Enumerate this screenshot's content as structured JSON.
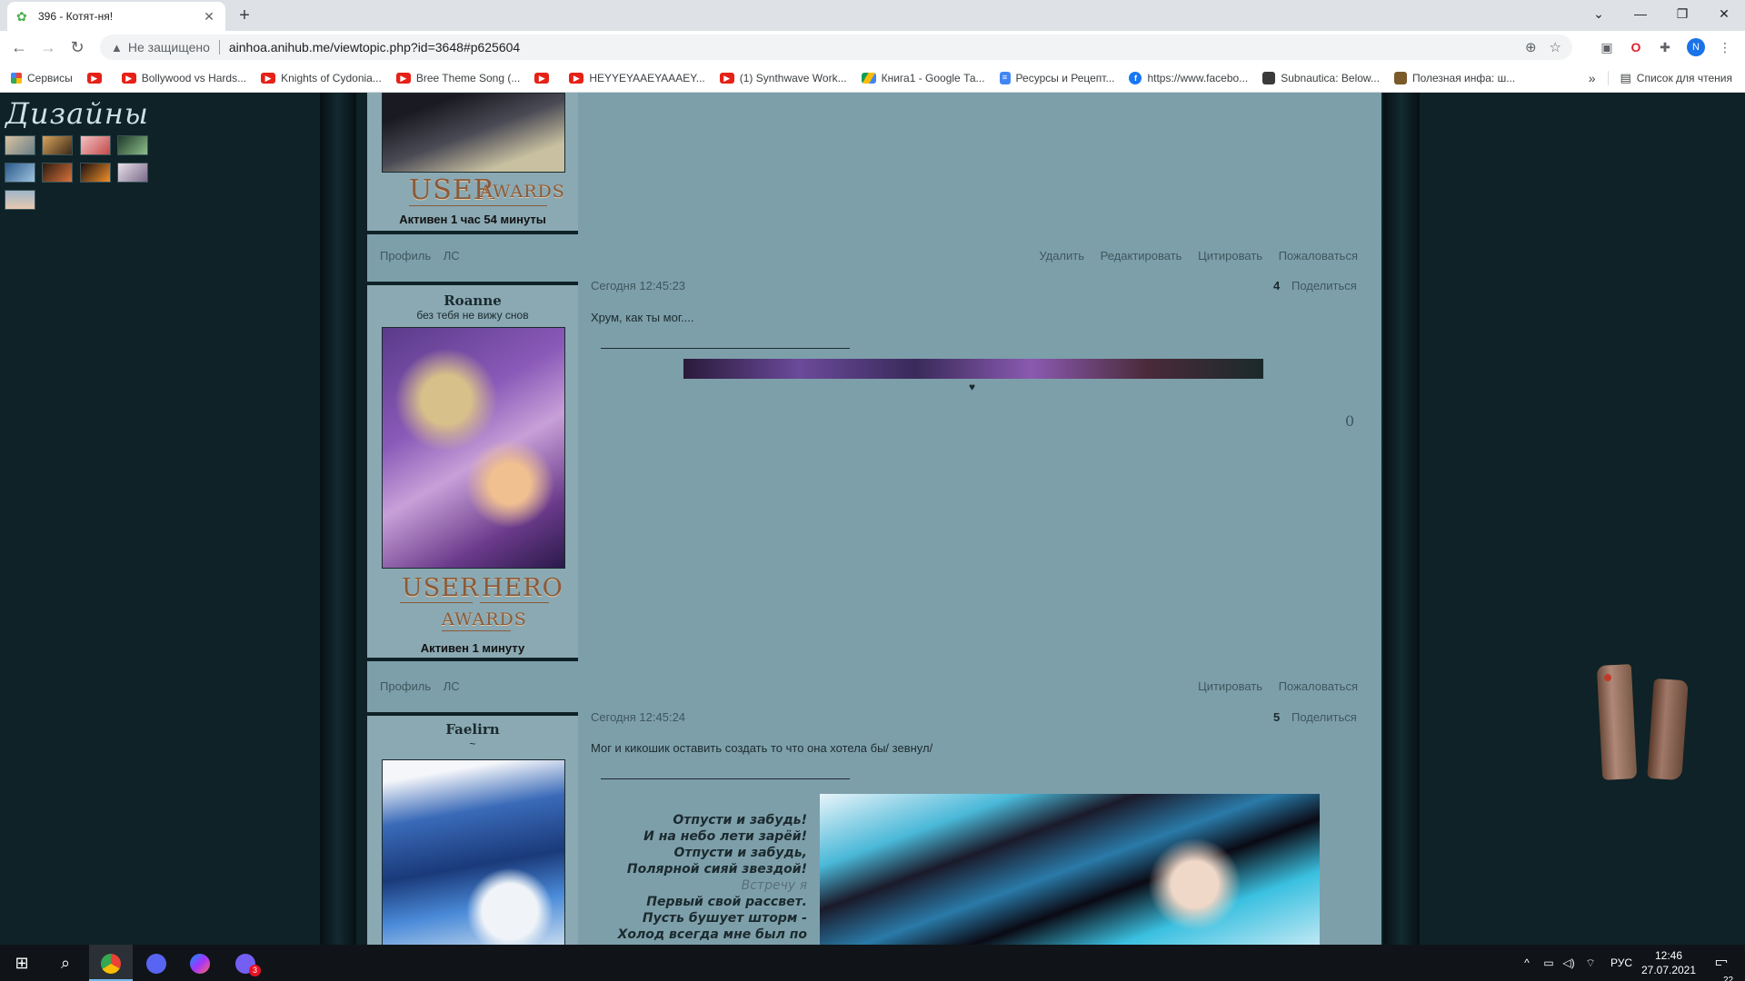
{
  "browser": {
    "tab_title": "396 - Котят-ня!",
    "tab_close": "✕",
    "new_tab": "+",
    "security_label": "Не защищено",
    "url": "ainhoa.anihub.me/viewtopic.php?id=3648#p625604",
    "profile_initial": "N",
    "bookmarks": [
      {
        "label": "Сервисы",
        "icon": "apps-icon"
      },
      {
        "label": "",
        "icon": "youtube-icon"
      },
      {
        "label": "Bollywood vs Hards...",
        "icon": "youtube-icon"
      },
      {
        "label": "Knights of Cydonia...",
        "icon": "youtube-icon"
      },
      {
        "label": "Bree Theme Song (...",
        "icon": "youtube-icon"
      },
      {
        "label": "",
        "icon": "youtube-icon"
      },
      {
        "label": "HEYYEYAAEYAAAEY...",
        "icon": "youtube-icon"
      },
      {
        "label": "(1) Synthwave Work...",
        "icon": "youtube-icon"
      },
      {
        "label": "Книга1 - Google Та...",
        "icon": "drive-icon"
      },
      {
        "label": "Ресурсы и Рецепт...",
        "icon": "docs-icon"
      },
      {
        "label": "https://www.facebo...",
        "icon": "facebook-icon"
      },
      {
        "label": "Subnautica: Below...",
        "icon": "site-icon"
      },
      {
        "label": "Полезная инфа: ш...",
        "icon": "site-icon"
      }
    ],
    "bookmarks_more": "»",
    "reading_list": "Список для чтения"
  },
  "sidebar": {
    "title": "Дизайны"
  },
  "posts": [
    {
      "active": "Активен 1 час 54 минуты",
      "award_left": "USER",
      "award_right": "AWARDS",
      "links_left": [
        "Профиль",
        "ЛС"
      ],
      "links_right": [
        "Удалить",
        "Редактировать",
        "Цитировать",
        "Пожаловаться"
      ]
    },
    {
      "username": "Roanne",
      "usertitle": "без тебя не вижу снов",
      "date": "Сегодня 12:45:23",
      "num": "4",
      "share": "Поделиться",
      "text": "Хрум, как ты мог....",
      "heart": "♥",
      "score": "0",
      "award_1": "USER",
      "award_2": "HERO",
      "award_3": "AWARDS",
      "active": "Активен 1 минуту",
      "links_left": [
        "Профиль",
        "ЛС"
      ],
      "links_right": [
        "Цитировать",
        "Пожаловаться"
      ]
    },
    {
      "username": "Faelirn",
      "usertitle": "~",
      "date": "Сегодня 12:45:24",
      "num": "5",
      "share": "Поделиться",
      "text": "Мог и кикошик оставить создать то что она хотела бы/ зевнул/",
      "poem": [
        "Отпусти и забудь!",
        "И на небо лети зарёй!",
        "Отпусти и забудь,",
        "Полярной сияй звездой!",
        "Встречу я",
        "Первый свой рассвет.",
        "Пусть бушует шторм -",
        "Холод всегда мне был по душе."
      ]
    }
  ],
  "taskbar": {
    "lang": "РУС",
    "time": "12:46",
    "date": "27.07.2021",
    "notifications": "22",
    "viber_badge": "3"
  },
  "colors": {
    "forum_bg": "#7d9faa",
    "award": "#8a5a3a",
    "page_bg": "#0e2227"
  }
}
